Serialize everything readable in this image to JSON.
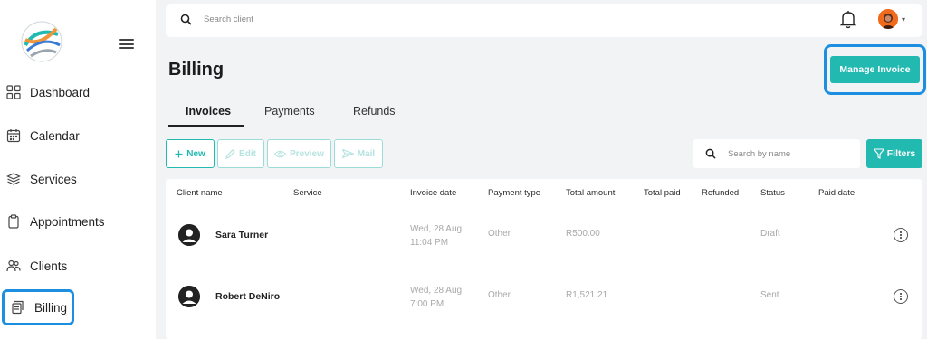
{
  "sidebar": {
    "items": [
      {
        "label": "Dashboard",
        "icon": "dashboard-icon"
      },
      {
        "label": "Calendar",
        "icon": "calendar-icon"
      },
      {
        "label": "Services",
        "icon": "layers-icon"
      },
      {
        "label": "Appointments",
        "icon": "clipboard-icon"
      },
      {
        "label": "Clients",
        "icon": "users-icon"
      },
      {
        "label": "Billing",
        "icon": "receipt-icon",
        "active": true
      }
    ]
  },
  "header": {
    "search_placeholder": "Search client"
  },
  "page": {
    "title": "Billing",
    "manage_invoice_label": "Manage Invoice"
  },
  "tabs": [
    {
      "label": "Invoices",
      "active": true
    },
    {
      "label": "Payments"
    },
    {
      "label": "Refunds"
    }
  ],
  "actions": {
    "new_label": "New",
    "edit_label": "Edit",
    "preview_label": "Preview",
    "mail_label": "Mail",
    "search_placeholder": "Search by name",
    "filters_label": "Filters"
  },
  "table": {
    "columns": [
      "Client name",
      "Service",
      "Invoice date",
      "Payment type",
      "Total amount",
      "Total paid",
      "Refunded",
      "Status",
      "Paid date"
    ],
    "rows": [
      {
        "client": "Sara Turner",
        "date_line1": "Wed, 28 Aug",
        "date_line2": "11:04 PM",
        "payment_type": "Other",
        "total_amount": "R500.00",
        "status": "Draft"
      },
      {
        "client": "Robert DeNiro",
        "date_line1": "Wed, 28 Aug",
        "date_line2": "7:00 PM",
        "payment_type": "Other",
        "total_amount": "R1,521.21",
        "status": "Sent"
      }
    ]
  },
  "colors": {
    "accent": "#22b9b1",
    "highlight": "#1d8fe0"
  }
}
